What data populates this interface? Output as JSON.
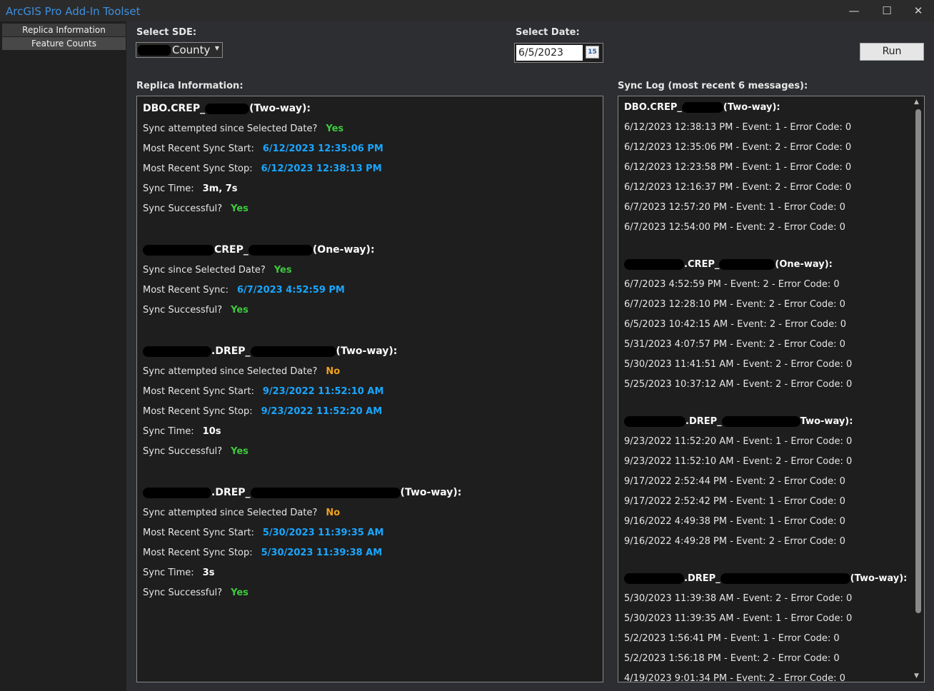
{
  "window": {
    "title": "ArcGIS Pro Add-In Toolset",
    "minimize": "—",
    "maximize": "☐",
    "close": "✕"
  },
  "sidebar": {
    "tabs": [
      {
        "label": "Replica Information"
      },
      {
        "label": "Feature Counts"
      }
    ]
  },
  "controls": {
    "sde_label": "Select SDE:",
    "sde_value": "County",
    "date_label": "Select Date:",
    "date_value": "6/5/2023",
    "calendar_icon_text": "15",
    "run_label": "Run"
  },
  "replica": {
    "heading": "Replica Information:",
    "blocks": [
      {
        "title_prefix": "DBO.CREP_",
        "title_suffix": "(Two-way):",
        "rows": [
          {
            "key": "Sync attempted since Selected Date?",
            "value": "Yes",
            "style": "yes"
          },
          {
            "key": "Most Recent Sync Start:",
            "value": "6/12/2023 12:35:06 PM",
            "style": "blue"
          },
          {
            "key": "Most Recent Sync Stop:",
            "value": "6/12/2023 12:38:13 PM",
            "style": "blue"
          },
          {
            "key": "Sync Time:",
            "value": "3m, 7s",
            "style": "white"
          },
          {
            "key": "Sync Successful?",
            "value": "Yes",
            "style": "yes"
          }
        ]
      },
      {
        "title_prefix": "CREP_",
        "title_suffix": "(One-way):",
        "rows": [
          {
            "key": "Sync since Selected Date?",
            "value": "Yes",
            "style": "yes"
          },
          {
            "key": "Most Recent Sync:",
            "value": "6/7/2023 4:52:59 PM",
            "style": "blue"
          },
          {
            "key": "Sync Successful?",
            "value": "Yes",
            "style": "yes"
          }
        ]
      },
      {
        "title_prefix": ".DREP_",
        "title_suffix": "(Two-way):",
        "rows": [
          {
            "key": "Sync attempted since Selected Date?",
            "value": "No",
            "style": "no"
          },
          {
            "key": "Most Recent Sync Start:",
            "value": "9/23/2022 11:52:10 AM",
            "style": "blue"
          },
          {
            "key": "Most Recent Sync Stop:",
            "value": "9/23/2022 11:52:20 AM",
            "style": "blue"
          },
          {
            "key": "Sync Time:",
            "value": "10s",
            "style": "white"
          },
          {
            "key": "Sync Successful?",
            "value": "Yes",
            "style": "yes"
          }
        ]
      },
      {
        "title_prefix": ".DREP_",
        "title_suffix": "(Two-way):",
        "rows": [
          {
            "key": "Sync attempted since Selected Date?",
            "value": "No",
            "style": "no"
          },
          {
            "key": "Most Recent Sync Start:",
            "value": "5/30/2023 11:39:35 AM",
            "style": "blue"
          },
          {
            "key": "Most Recent Sync Stop:",
            "value": "5/30/2023 11:39:38 AM",
            "style": "blue"
          },
          {
            "key": "Sync Time:",
            "value": "3s",
            "style": "white"
          },
          {
            "key": "Sync Successful?",
            "value": "Yes",
            "style": "yes"
          }
        ]
      }
    ]
  },
  "synclog": {
    "heading": "Sync Log (most recent 6 messages):",
    "groups": [
      {
        "title_prefix": "DBO.CREP_",
        "title_suffix": "(Two-way):",
        "entries": [
          "6/12/2023 12:38:13 PM - Event: 1 - Error Code: 0",
          "6/12/2023 12:35:06 PM - Event: 2 - Error Code: 0",
          "6/12/2023 12:23:58 PM - Event: 1 - Error Code: 0",
          "6/12/2023 12:16:37 PM - Event: 2 - Error Code: 0",
          "6/7/2023 12:57:20 PM - Event: 1 - Error Code: 0",
          "6/7/2023 12:54:00 PM - Event: 2 - Error Code: 0"
        ]
      },
      {
        "title_prefix": ".CREP_",
        "title_suffix": "(One-way):",
        "entries": [
          "6/7/2023 4:52:59 PM - Event: 2 - Error Code: 0",
          "6/7/2023 12:28:10 PM - Event: 2 - Error Code: 0",
          "6/5/2023 10:42:15 AM - Event: 2 - Error Code: 0",
          "5/31/2023 4:07:57 PM - Event: 2 - Error Code: 0",
          "5/30/2023 11:41:51 AM - Event: 2 - Error Code: 0",
          "5/25/2023 10:37:12 AM - Event: 2 - Error Code: 0"
        ]
      },
      {
        "title_prefix": ".DREP_",
        "title_suffix": "Two-way):",
        "entries": [
          "9/23/2022 11:52:20 AM - Event: 1 - Error Code: 0",
          "9/23/2022 11:52:10 AM - Event: 2 - Error Code: 0",
          "9/17/2022 2:52:44 PM - Event: 2 - Error Code: 0",
          "9/17/2022 2:52:42 PM - Event: 1 - Error Code: 0",
          "9/16/2022 4:49:38 PM - Event: 1 - Error Code: 0",
          "9/16/2022 4:49:28 PM - Event: 2 - Error Code: 0"
        ]
      },
      {
        "title_prefix": ".DREP_",
        "title_suffix": "(Two-way):",
        "entries": [
          "5/30/2023 11:39:38 AM - Event: 2 - Error Code: 0",
          "5/30/2023 11:39:35 AM - Event: 1 - Error Code: 0",
          "5/2/2023 1:56:41 PM - Event: 1 - Error Code: 0",
          "5/2/2023 1:56:18 PM - Event: 2 - Error Code: 0",
          "4/19/2023 9:01:34 PM - Event: 2 - Error Code: 0"
        ]
      }
    ]
  }
}
